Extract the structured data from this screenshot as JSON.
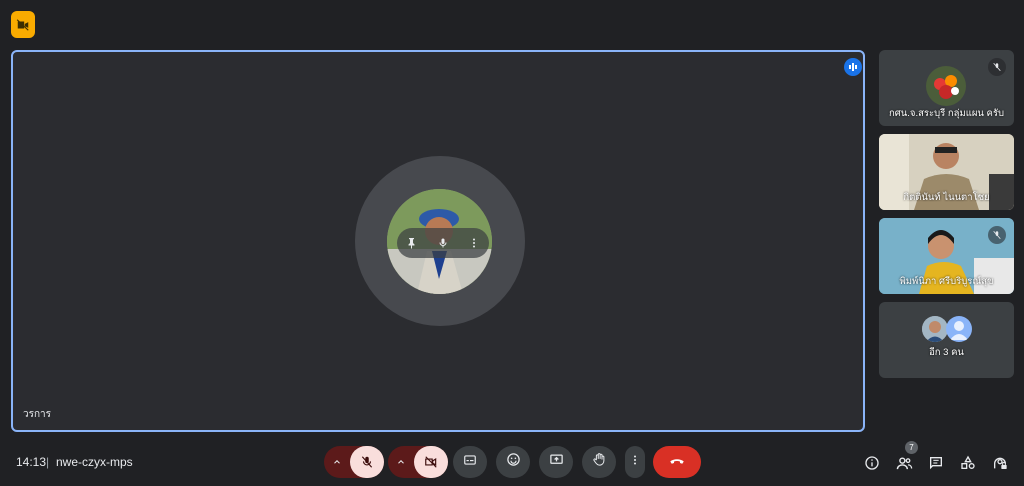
{
  "main": {
    "speaker_name": "วรการ"
  },
  "participants": [
    {
      "name": "กศน.จ.สระบุรี กลุ่มแผน ครับ",
      "muted": true
    },
    {
      "name": "กิตตินันท์ ไนนตาโชย",
      "muted": false
    },
    {
      "name": "พิมพ์นิภา ศรีบริบูรณ์สุข",
      "muted": true
    }
  ],
  "others": {
    "label": "อีก 3 คน"
  },
  "footer": {
    "time": "14:13",
    "separator": "|",
    "meeting_code": "nwe-czyx-mps",
    "people_count": "7"
  },
  "colors": {
    "accent": "#8ab4f8",
    "hangup": "#d93025",
    "off_button_bg": "#f9dedc",
    "badge": "#f9ab00"
  },
  "icons": [
    "camera-off-icon",
    "pin-icon",
    "mic-icon",
    "more-vert-icon",
    "audio-level-icon",
    "mic-off-icon",
    "chevron-up-icon",
    "video-off-icon",
    "captions-icon",
    "emoji-icon",
    "present-icon",
    "raise-hand-icon",
    "call-end-icon",
    "info-icon",
    "people-icon",
    "chat-icon",
    "activities-icon",
    "host-controls-icon"
  ]
}
